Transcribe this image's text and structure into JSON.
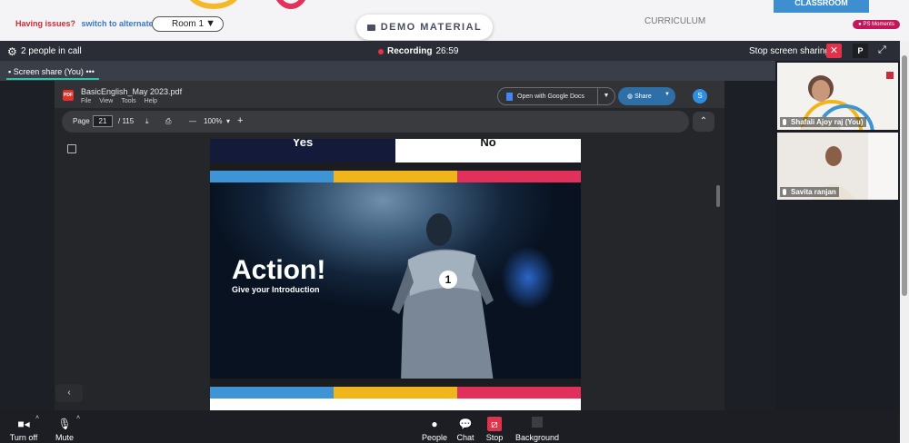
{
  "topbar": {
    "issue_text": "Having issues?",
    "switch_link": "switch to alternate room",
    "room_select": "Room 1",
    "demo_material": "DEMO MATERIAL",
    "curriculum": "CURRICULUM",
    "classroom_badge": "CLASSROOM",
    "ps_moments": "PS Moments"
  },
  "callbar": {
    "people_count": "2 people in call",
    "recording_label": "Recording",
    "recording_time": "26:59",
    "stop_sharing": "Stop screen sharing",
    "p_label": "P"
  },
  "share_tab": {
    "label": "Screen share (You)",
    "menu": "•••"
  },
  "pdf_viewer": {
    "filename": "BasicEnglish_May 2023.pdf",
    "menu": [
      "File",
      "View",
      "Tools",
      "Help"
    ],
    "open_docs": "Open with Google Docs",
    "share_label": "Share",
    "avatar_letter": "S",
    "page_label": "Page",
    "page_current": "21",
    "page_total": "/  115",
    "zoom": "100%",
    "pdf_icon_text": "PDF"
  },
  "slide": {
    "yes": "Yes",
    "no": "No",
    "title": "Action!",
    "subtitle": "Give your Introduction",
    "number": "1",
    "stripe_colors": [
      "#3e94d4",
      "#f1b51c",
      "#e1305a"
    ]
  },
  "participants": [
    {
      "name": "Shafali Ajoy raj (You)"
    },
    {
      "name": "Savita ranjan"
    }
  ],
  "bottombar": {
    "turn_off": "Turn off",
    "mute": "Mute",
    "people": "People",
    "chat": "Chat",
    "stop": "Stop",
    "background": "Background"
  }
}
